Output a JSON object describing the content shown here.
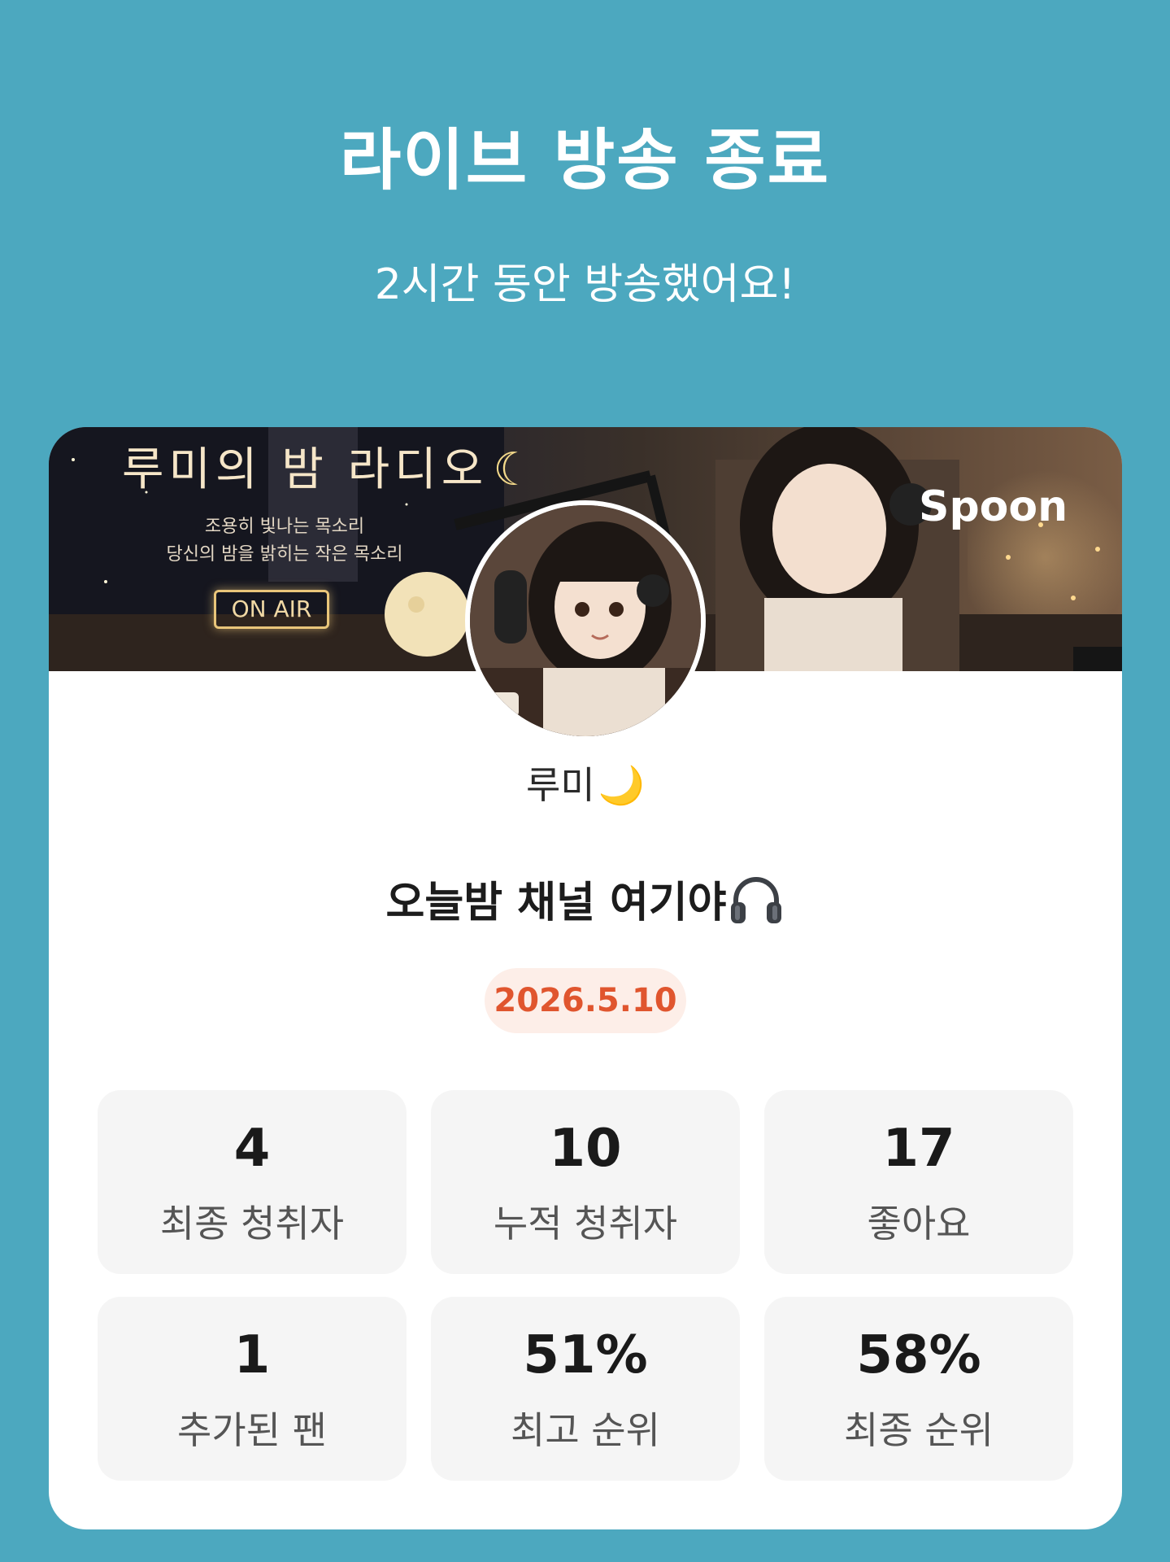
{
  "header": {
    "title": "라이브 방송 종료",
    "subtitle": "2시간 동안 방송했어요!"
  },
  "banner": {
    "title": "루미의 밤 라디오",
    "title_moon": "☾",
    "line1": "조용히 빛나는 목소리",
    "line2": "당신의 밤을 밝히는 작은 목소리",
    "onair": "ON AIR",
    "brand": "Spoon"
  },
  "profile": {
    "nickname": "루미",
    "nickname_icon": "crescent-moon-icon",
    "nickname_moon": "🌙"
  },
  "broadcast": {
    "title": "오늘밤 채널 여기야",
    "title_icon": "headphone-icon",
    "date": "2026.5.10"
  },
  "stats": [
    {
      "value": "4",
      "label": "최종 청취자"
    },
    {
      "value": "10",
      "label": "누적 청취자"
    },
    {
      "value": "17",
      "label": "좋아요"
    },
    {
      "value": "1",
      "label": "추가된 팬"
    },
    {
      "value": "51%",
      "label": "최고 순위"
    },
    {
      "value": "58%",
      "label": "최종 순위"
    }
  ],
  "colors": {
    "background": "#4ca8bf",
    "card": "#ffffff",
    "stat_card": "#f5f5f5",
    "date_text": "#e0552e",
    "date_bg": "#fdeee8"
  }
}
